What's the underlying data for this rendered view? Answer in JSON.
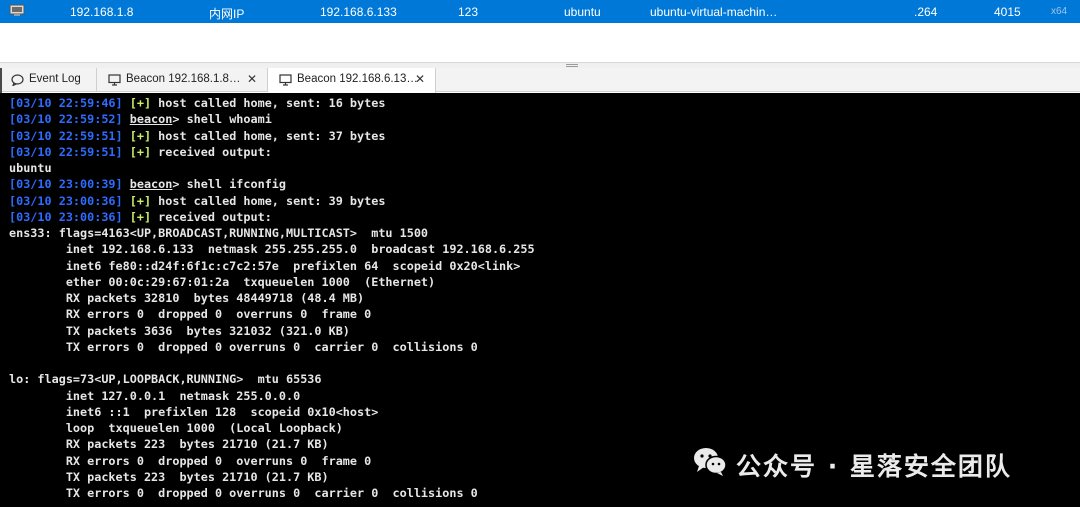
{
  "session": {
    "external_ip": "192.168.1.8",
    "network": "内网IP",
    "internal_ip": "192.168.6.133",
    "listener": "123",
    "user": "ubuntu",
    "computer": "ubuntu-virtual-machin…",
    "note": ".264",
    "pid": "4015",
    "arch": "x64",
    "row_color": "#0078d7"
  },
  "tabs": [
    {
      "label": "Event Log",
      "icon": "chat-icon"
    },
    {
      "label": "Beacon 192.168.1.8…",
      "icon": "monitor-icon",
      "close": "✕"
    },
    {
      "label": "Beacon 192.168.6.13…",
      "icon": "monitor-icon",
      "close": "✕",
      "active": true
    }
  ],
  "console": {
    "lines": [
      "[03/10 22:59:46] [+] host called home, sent: 16 bytes",
      "[03/10 22:59:52] beacon> shell whoami",
      "[03/10 22:59:51] [+] host called home, sent: 37 bytes",
      "[03/10 22:59:51] [+] received output:",
      "ubuntu",
      "[03/10 23:00:39] beacon> shell ifconfig",
      "[03/10 23:00:36] [+] host called home, sent: 39 bytes",
      "[03/10 23:00:36] [+] received output:",
      "ens33: flags=4163<UP,BROADCAST,RUNNING,MULTICAST>  mtu 1500",
      "        inet 192.168.6.133  netmask 255.255.255.0  broadcast 192.168.6.255",
      "        inet6 fe80::d24f:6f1c:c7c2:57e  prefixlen 64  scopeid 0x20<link>",
      "        ether 00:0c:29:67:01:2a  txqueuelen 1000  (Ethernet)",
      "        RX packets 32810  bytes 48449718 (48.4 MB)",
      "        RX errors 0  dropped 0  overruns 0  frame 0",
      "        TX packets 3636  bytes 321032 (321.0 KB)",
      "        TX errors 0  dropped 0 overruns 0  carrier 0  collisions 0",
      "",
      "lo: flags=73<UP,LOOPBACK,RUNNING>  mtu 65536",
      "        inet 127.0.0.1  netmask 255.0.0.0",
      "        inet6 ::1  prefixlen 128  scopeid 0x10<host>",
      "        loop  txqueuelen 1000  (Local Loopback)",
      "        RX packets 223  bytes 21710 (21.7 KB)",
      "        RX errors 0  dropped 0  overruns 0  frame 0",
      "        TX packets 223  bytes 21710 (21.7 KB)",
      "        TX errors 0  dropped 0 overruns 0  carrier 0  collisions 0"
    ],
    "colors": {
      "timestamp": "#2e6cff",
      "success": "#ccee66",
      "text": "#e6e6e6",
      "background": "#000000"
    }
  },
  "watermark": {
    "text": "公众号 · 星落安全团队",
    "icon": "wechat-icon"
  }
}
